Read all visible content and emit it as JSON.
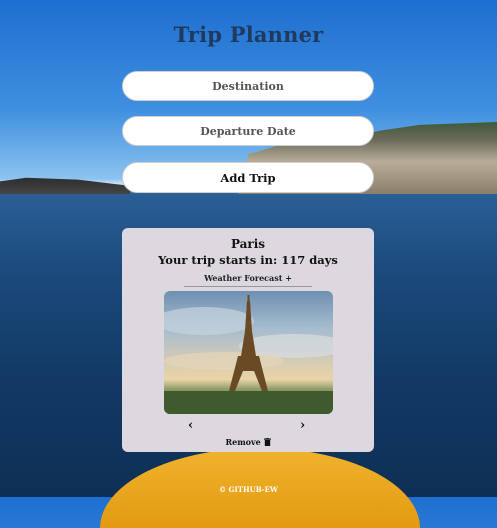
{
  "app": {
    "title": "Trip Planner"
  },
  "form": {
    "destination_placeholder": "Destination",
    "date_placeholder": "Departure Date",
    "add_label": "Add Trip"
  },
  "trip_card": {
    "city": "Paris",
    "countdown": "Your trip starts in: 117 days",
    "weather_toggle": "Weather Forecast +",
    "prev_label": "‹",
    "next_label": "›",
    "remove_label": "Remove"
  },
  "footer": {
    "credit": "© GITHUB-EW"
  },
  "icons": {
    "remove": "trash-icon"
  }
}
